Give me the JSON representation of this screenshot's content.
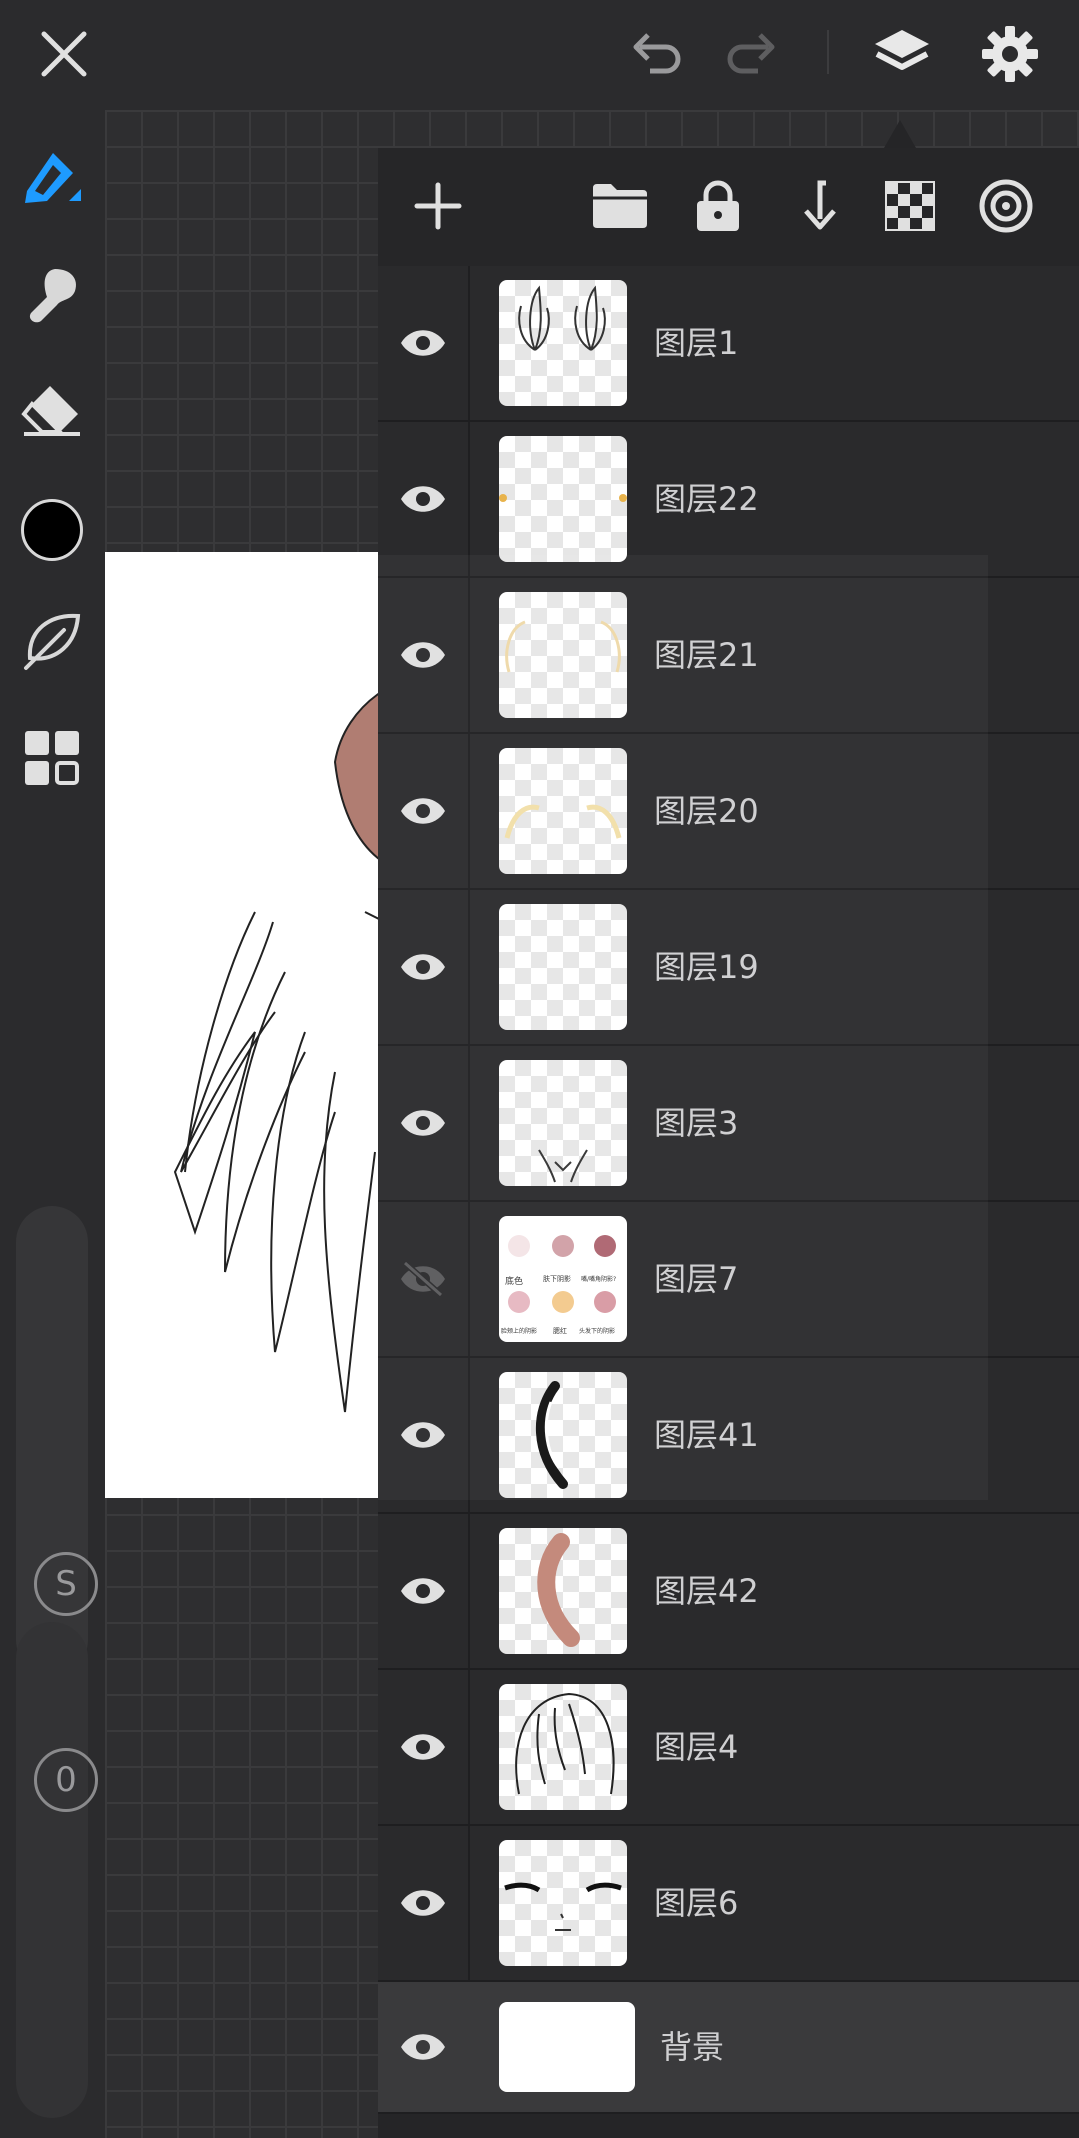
{
  "topbar": {
    "close_icon": "close-icon",
    "undo_icon": "undo-icon",
    "redo_icon": "redo-icon",
    "layers_icon": "layers-icon",
    "settings_icon": "gear-icon"
  },
  "toolbar": {
    "tools": [
      "pen-tool",
      "smudge-tool",
      "eraser-tool",
      "color-picker",
      "leaf-brush",
      "gallery-grid"
    ],
    "color": "#000000",
    "accent": "#1e9bff",
    "size_label": "S",
    "opacity_label": "0"
  },
  "layers_panel": {
    "actions": [
      "add-layer",
      "folder",
      "lock",
      "merge-down",
      "transparency",
      "blend"
    ],
    "layers": [
      {
        "name": "图层1",
        "visible": true
      },
      {
        "name": "图层22",
        "visible": true
      },
      {
        "name": "图层21",
        "visible": true
      },
      {
        "name": "图层20",
        "visible": true
      },
      {
        "name": "图层19",
        "visible": true
      },
      {
        "name": "图层3",
        "visible": true
      },
      {
        "name": "图层7",
        "visible": false
      },
      {
        "name": "图层41",
        "visible": true
      },
      {
        "name": "图层42",
        "visible": true
      },
      {
        "name": "图层4",
        "visible": true
      },
      {
        "name": "图层6",
        "visible": true
      },
      {
        "name": "背景",
        "visible": true,
        "selected": true
      }
    ],
    "swatch_labels": [
      "底色",
      "肤下阴影",
      "嘴/嘴角阴影?",
      "脸颊上的阴影",
      "腮红",
      "头发下的阴影"
    ]
  }
}
